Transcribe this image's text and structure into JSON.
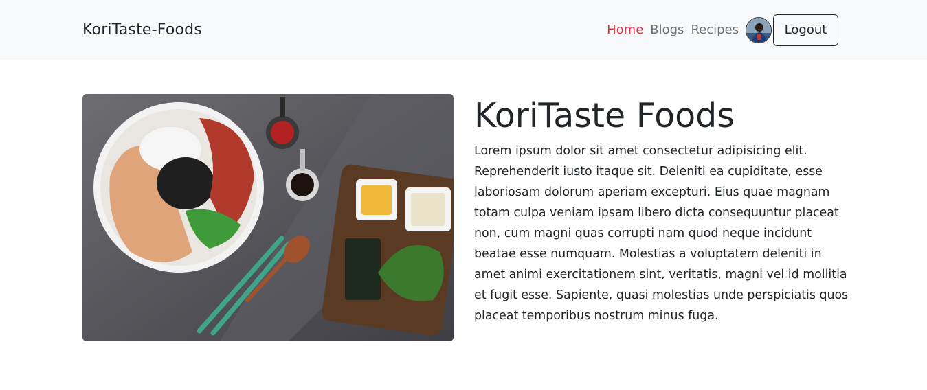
{
  "navbar": {
    "brand": "KoriTaste-Foods",
    "links": [
      {
        "label": "Home",
        "active": true
      },
      {
        "label": "Blogs",
        "active": false
      },
      {
        "label": "Recipes",
        "active": false
      }
    ],
    "logout_label": "Logout",
    "active_color": "#dc3545"
  },
  "hero": {
    "title": "KoriTaste Foods",
    "body": "Lorem ipsum dolor sit amet consectetur adipisicing elit. Reprehenderit iusto itaque sit. Deleniti ea cupiditate, esse laboriosam dolorum aperiam excepturi. Eius quae magnam totam culpa veniam ipsam libero dicta consequuntur placeat non, cum magni quas corrupti nam quod neque incidunt beatae esse numquam. Molestias a voluptatem deleniti in amet animi exercitationem sint, veritatis, magni vel id mollitia et fugit esse. Sapiente, quasi molestias unde perspiciatis quos placeat temporibus nostrum minus fuga."
  }
}
